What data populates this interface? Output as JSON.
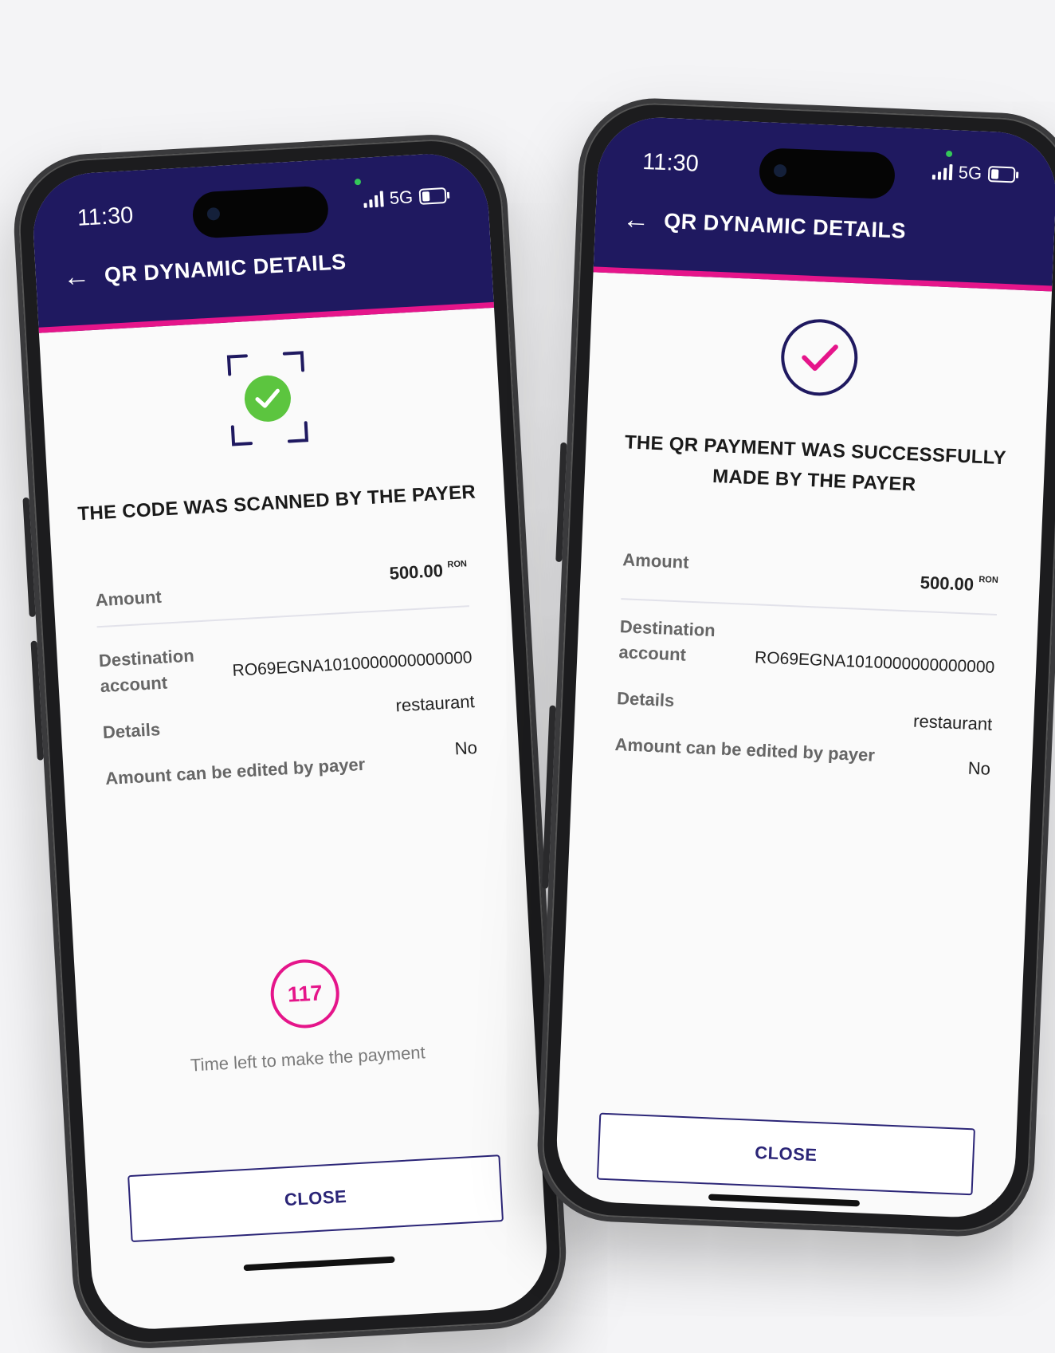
{
  "status_bar": {
    "time": "11:30",
    "network": "5G"
  },
  "header": {
    "title": "QR DYNAMIC DETAILS"
  },
  "phone_left": {
    "headline": "THE CODE WAS SCANNED BY THE PAYER",
    "details": {
      "amount_label": "Amount",
      "amount_value": "500.00",
      "currency": "RON",
      "destination_label_1": "Destination",
      "destination_label_2": "account",
      "destination_value": "RO69EGNA1010000000000000",
      "details_label": "Details",
      "details_value": "restaurant",
      "editable_label": "Amount can be edited by payer",
      "editable_value": "No"
    },
    "timer": {
      "value": "117",
      "caption": "Time left to make the payment"
    },
    "close_label": "CLOSE"
  },
  "phone_right": {
    "headline_line1": "THE QR PAYMENT WAS SUCCESSFULLY",
    "headline_line2": "MADE BY THE PAYER",
    "details": {
      "amount_label": "Amount",
      "amount_value": "500.00",
      "currency": "RON",
      "destination_label_1": "Destination",
      "destination_label_2": "account",
      "destination_value": "RO69EGNA1010000000000000",
      "details_label": "Details",
      "details_value": "restaurant",
      "editable_label": "Amount can be edited by payer",
      "editable_value": "No"
    },
    "close_label": "CLOSE"
  },
  "colors": {
    "header_bg": "#1f1960",
    "accent_pink": "#e5158a",
    "success_green": "#5cc53f",
    "button_text": "#2b2577"
  }
}
